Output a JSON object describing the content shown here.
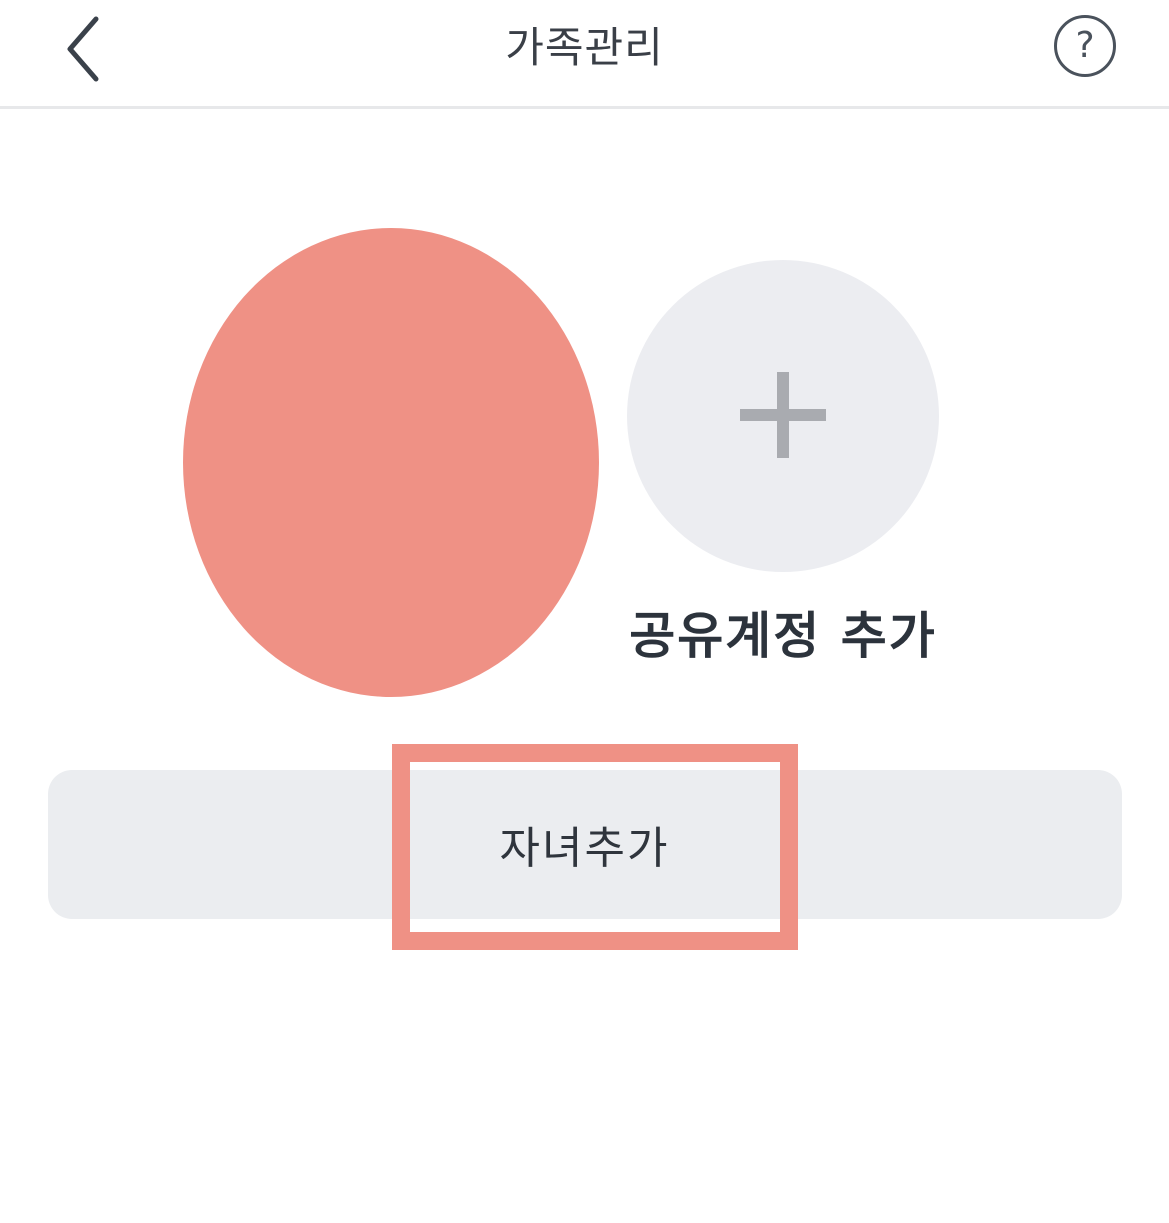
{
  "header": {
    "title": "가족관리",
    "back_icon": "chevron-left-icon",
    "help_label": "?",
    "help_icon": "help-circle-icon"
  },
  "family": {
    "add_shared_account_label": "공유계정 추가",
    "add_icon": "plus-icon",
    "add_child_label": "자녀추가"
  },
  "colors": {
    "avatar": "#ef9185",
    "highlight": "#ef9185",
    "add_circle": "#ecedf1",
    "bar": "#ebedf0",
    "text_dark": "#2c333c"
  }
}
